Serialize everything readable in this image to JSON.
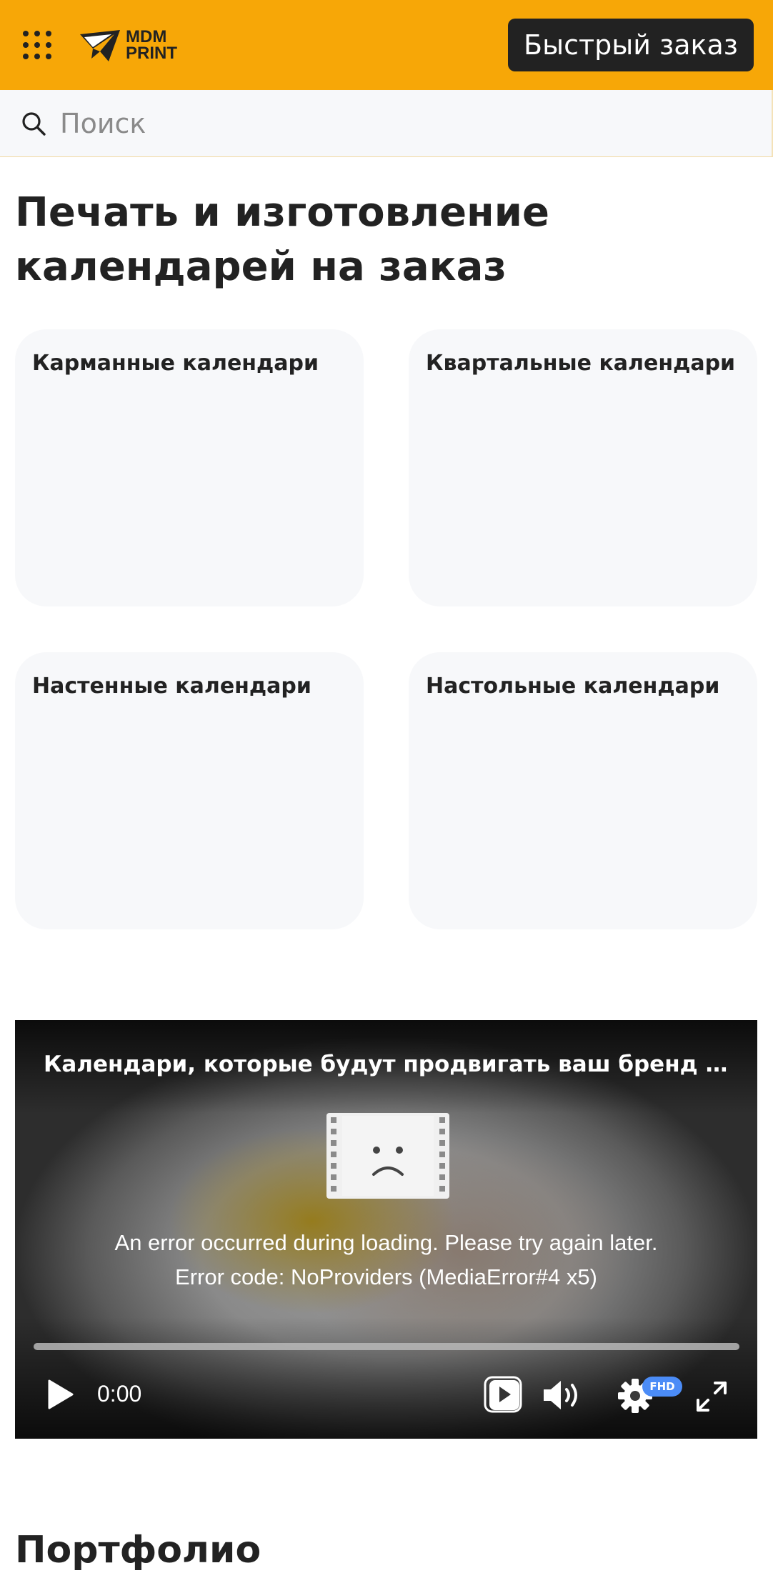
{
  "header": {
    "brand_color": "#f7a707",
    "menu_icon": "grid-dots-icon",
    "logo": {
      "line1": "MDM",
      "line2": "PRINT",
      "icon": "paper-plane-icon"
    },
    "quick_order_label": "Быстрый заказ"
  },
  "search": {
    "placeholder": "Поиск",
    "value": "",
    "icon": "search-icon"
  },
  "main": {
    "title_line1": "Печать и изготовление",
    "title_line2": "календарей на заказ",
    "categories": [
      {
        "label": "Карманные календари"
      },
      {
        "label": "Квартальные календари"
      },
      {
        "label": "Настенные календари"
      },
      {
        "label": "Настольные календари"
      }
    ]
  },
  "video": {
    "title": "Календари, которые будут продвигать ваш бренд || Типография MDM PRINT",
    "error_line1": "An error occurred during loading. Please try again later.",
    "error_line2": "Error code: NoProviders (MediaError#4 x5)",
    "time": "0:00",
    "quality_badge": "FHD",
    "controls": [
      "play-icon",
      "picture-in-picture-icon",
      "volume-icon",
      "settings-gear-icon",
      "fullscreen-icon"
    ]
  },
  "portfolio": {
    "heading": "Портфолио"
  }
}
